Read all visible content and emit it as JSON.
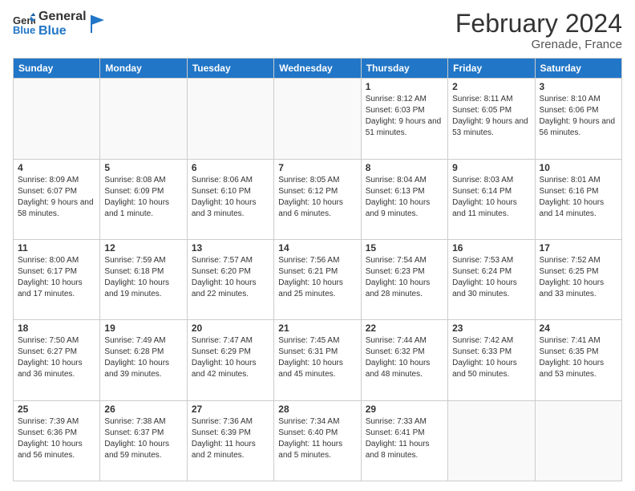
{
  "logo": {
    "line1": "General",
    "line2": "Blue"
  },
  "header": {
    "title": "February 2024",
    "subtitle": "Grenade, France"
  },
  "weekdays": [
    "Sunday",
    "Monday",
    "Tuesday",
    "Wednesday",
    "Thursday",
    "Friday",
    "Saturday"
  ],
  "weeks": [
    [
      {
        "day": "",
        "info": ""
      },
      {
        "day": "",
        "info": ""
      },
      {
        "day": "",
        "info": ""
      },
      {
        "day": "",
        "info": ""
      },
      {
        "day": "1",
        "info": "Sunrise: 8:12 AM\nSunset: 6:03 PM\nDaylight: 9 hours and 51 minutes."
      },
      {
        "day": "2",
        "info": "Sunrise: 8:11 AM\nSunset: 6:05 PM\nDaylight: 9 hours and 53 minutes."
      },
      {
        "day": "3",
        "info": "Sunrise: 8:10 AM\nSunset: 6:06 PM\nDaylight: 9 hours and 56 minutes."
      }
    ],
    [
      {
        "day": "4",
        "info": "Sunrise: 8:09 AM\nSunset: 6:07 PM\nDaylight: 9 hours and 58 minutes."
      },
      {
        "day": "5",
        "info": "Sunrise: 8:08 AM\nSunset: 6:09 PM\nDaylight: 10 hours and 1 minute."
      },
      {
        "day": "6",
        "info": "Sunrise: 8:06 AM\nSunset: 6:10 PM\nDaylight: 10 hours and 3 minutes."
      },
      {
        "day": "7",
        "info": "Sunrise: 8:05 AM\nSunset: 6:12 PM\nDaylight: 10 hours and 6 minutes."
      },
      {
        "day": "8",
        "info": "Sunrise: 8:04 AM\nSunset: 6:13 PM\nDaylight: 10 hours and 9 minutes."
      },
      {
        "day": "9",
        "info": "Sunrise: 8:03 AM\nSunset: 6:14 PM\nDaylight: 10 hours and 11 minutes."
      },
      {
        "day": "10",
        "info": "Sunrise: 8:01 AM\nSunset: 6:16 PM\nDaylight: 10 hours and 14 minutes."
      }
    ],
    [
      {
        "day": "11",
        "info": "Sunrise: 8:00 AM\nSunset: 6:17 PM\nDaylight: 10 hours and 17 minutes."
      },
      {
        "day": "12",
        "info": "Sunrise: 7:59 AM\nSunset: 6:18 PM\nDaylight: 10 hours and 19 minutes."
      },
      {
        "day": "13",
        "info": "Sunrise: 7:57 AM\nSunset: 6:20 PM\nDaylight: 10 hours and 22 minutes."
      },
      {
        "day": "14",
        "info": "Sunrise: 7:56 AM\nSunset: 6:21 PM\nDaylight: 10 hours and 25 minutes."
      },
      {
        "day": "15",
        "info": "Sunrise: 7:54 AM\nSunset: 6:23 PM\nDaylight: 10 hours and 28 minutes."
      },
      {
        "day": "16",
        "info": "Sunrise: 7:53 AM\nSunset: 6:24 PM\nDaylight: 10 hours and 30 minutes."
      },
      {
        "day": "17",
        "info": "Sunrise: 7:52 AM\nSunset: 6:25 PM\nDaylight: 10 hours and 33 minutes."
      }
    ],
    [
      {
        "day": "18",
        "info": "Sunrise: 7:50 AM\nSunset: 6:27 PM\nDaylight: 10 hours and 36 minutes."
      },
      {
        "day": "19",
        "info": "Sunrise: 7:49 AM\nSunset: 6:28 PM\nDaylight: 10 hours and 39 minutes."
      },
      {
        "day": "20",
        "info": "Sunrise: 7:47 AM\nSunset: 6:29 PM\nDaylight: 10 hours and 42 minutes."
      },
      {
        "day": "21",
        "info": "Sunrise: 7:45 AM\nSunset: 6:31 PM\nDaylight: 10 hours and 45 minutes."
      },
      {
        "day": "22",
        "info": "Sunrise: 7:44 AM\nSunset: 6:32 PM\nDaylight: 10 hours and 48 minutes."
      },
      {
        "day": "23",
        "info": "Sunrise: 7:42 AM\nSunset: 6:33 PM\nDaylight: 10 hours and 50 minutes."
      },
      {
        "day": "24",
        "info": "Sunrise: 7:41 AM\nSunset: 6:35 PM\nDaylight: 10 hours and 53 minutes."
      }
    ],
    [
      {
        "day": "25",
        "info": "Sunrise: 7:39 AM\nSunset: 6:36 PM\nDaylight: 10 hours and 56 minutes."
      },
      {
        "day": "26",
        "info": "Sunrise: 7:38 AM\nSunset: 6:37 PM\nDaylight: 10 hours and 59 minutes."
      },
      {
        "day": "27",
        "info": "Sunrise: 7:36 AM\nSunset: 6:39 PM\nDaylight: 11 hours and 2 minutes."
      },
      {
        "day": "28",
        "info": "Sunrise: 7:34 AM\nSunset: 6:40 PM\nDaylight: 11 hours and 5 minutes."
      },
      {
        "day": "29",
        "info": "Sunrise: 7:33 AM\nSunset: 6:41 PM\nDaylight: 11 hours and 8 minutes."
      },
      {
        "day": "",
        "info": ""
      },
      {
        "day": "",
        "info": ""
      }
    ]
  ]
}
